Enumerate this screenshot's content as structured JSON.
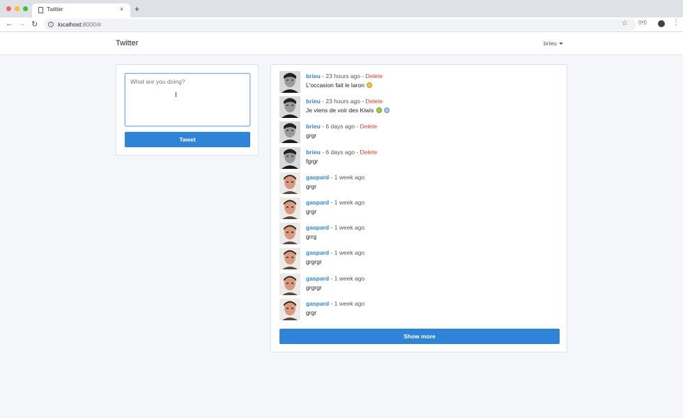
{
  "browser": {
    "tab_title": "Twitter",
    "tab_close": "×",
    "new_tab": "+",
    "url_host": "localhost",
    "url_rest": ":8000/#"
  },
  "navbar": {
    "brand": "Twitter",
    "user": "brieu"
  },
  "compose": {
    "placeholder": "What are you doing?",
    "value": "",
    "tweet_button": "Tweet"
  },
  "feed": {
    "tweets": [
      {
        "author": "brieu",
        "time": "23 hours ago",
        "can_delete": true,
        "delete_label": "Delete",
        "text": "L'occasion fait le laron",
        "emoji": [
          "grimace-face"
        ]
      },
      {
        "author": "brieu",
        "time": "23 hours ago",
        "can_delete": true,
        "delete_label": "Delete",
        "text": "Je viens de voir des Kiwis",
        "emoji": [
          "nauseated-face",
          "screaming-face"
        ]
      },
      {
        "author": "brieu",
        "time": "6 days ago",
        "can_delete": true,
        "delete_label": "Delete",
        "text": "grgr",
        "emoji": []
      },
      {
        "author": "brieu",
        "time": "6 days ago",
        "can_delete": true,
        "delete_label": "Delete",
        "text": "fgrgr",
        "emoji": []
      },
      {
        "author": "gaspard",
        "time": "1 week ago",
        "can_delete": false,
        "delete_label": "",
        "text": "grgr",
        "emoji": []
      },
      {
        "author": "gaspard",
        "time": "1 week ago",
        "can_delete": false,
        "delete_label": "",
        "text": "grgr",
        "emoji": []
      },
      {
        "author": "gaspard",
        "time": "1 week ago",
        "can_delete": false,
        "delete_label": "",
        "text": "grrg",
        "emoji": []
      },
      {
        "author": "gaspard",
        "time": "1 week ago",
        "can_delete": false,
        "delete_label": "",
        "text": "grgrgr",
        "emoji": []
      },
      {
        "author": "gaspard",
        "time": "1 week ago",
        "can_delete": false,
        "delete_label": "",
        "text": "grgrgr",
        "emoji": []
      },
      {
        "author": "gaspard",
        "time": "1 week ago",
        "can_delete": false,
        "delete_label": "",
        "text": "grgr",
        "emoji": []
      }
    ],
    "separator": " - ",
    "show_more": "Show more"
  },
  "colors": {
    "accent": "#2f84d8",
    "delete": "#e23b30",
    "background": "#f4f6fa"
  }
}
